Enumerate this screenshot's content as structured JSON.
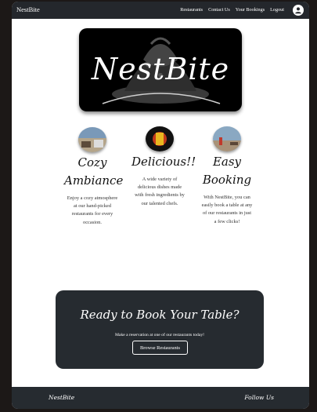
{
  "nav": {
    "brand": "NestBite",
    "links": [
      "Restaurants",
      "Contact Us",
      "Your Bookings",
      "Logout"
    ],
    "profile_icon": "user-icon"
  },
  "hero": {
    "logo_text": "NestBite"
  },
  "features": [
    {
      "title_line1": "Cozy",
      "title_line2": "Ambiance",
      "text": "Enjoy a cozy atmosphere at our hand-picked restaurants for every occasion."
    },
    {
      "title_line1": "Delicious!!",
      "title_line2": "",
      "text": "A wide variety of delicious dishes made with fresh ingredients by our talented chefs."
    },
    {
      "title_line1": "Easy",
      "title_line2": "Booking",
      "text": "With NestBite, you can easily book a table at any of our restaurants in just a few clicks!"
    }
  ],
  "cta": {
    "title": "Ready to Book Your Table?",
    "subtitle": "Make a reservation at one of our restaurants today!",
    "button": "Browse Restaurants"
  },
  "footer": {
    "brand": "NestBite",
    "follow": "Follow Us"
  },
  "colors": {
    "dark": "#24272c",
    "page_bg": "#1c1817",
    "accent": "#ffffff"
  }
}
